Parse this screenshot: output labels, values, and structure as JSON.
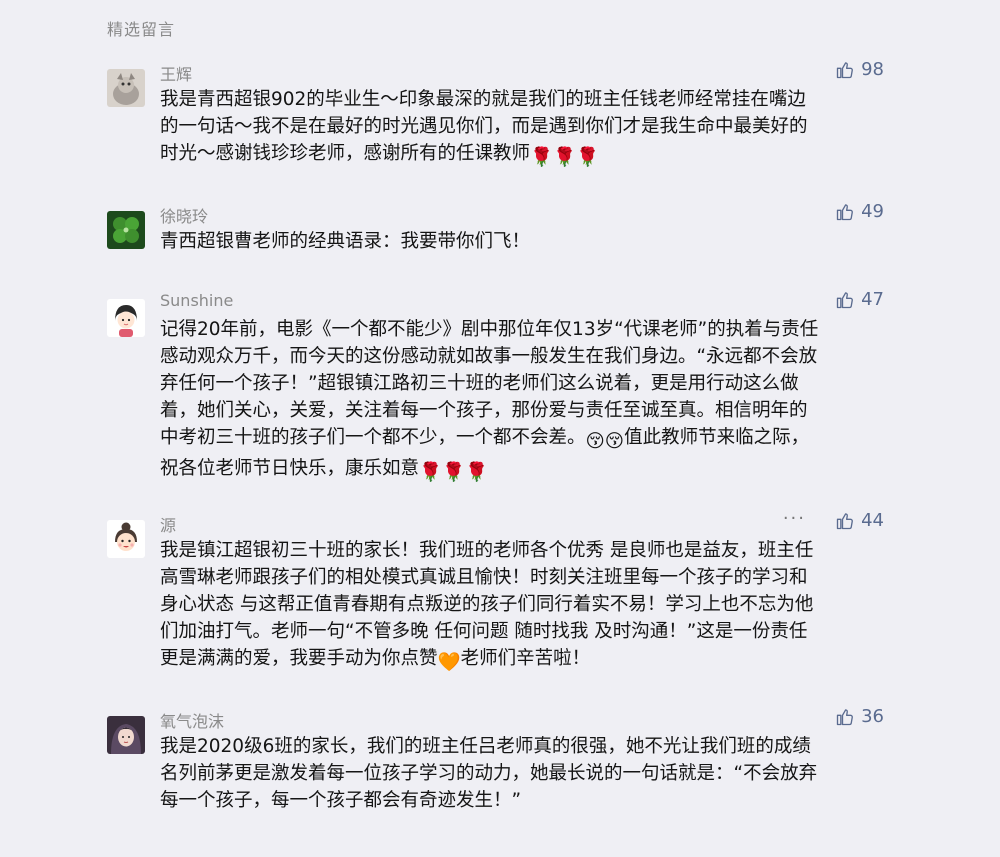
{
  "section_title": "精选留言",
  "comments": [
    {
      "name": "王辉",
      "likes": "98",
      "text": "我是青西超银902的毕业生～印象最深的就是我们的班主任钱老师经常挂在嘴边\n的一句话～我不是在最好的时光遇见你们，而是遇到你们才是我生命中最美好的\n时光～感谢钱珍珍老师，感谢所有的任课教师",
      "emoji_suffix": "🌹🌹🌹"
    },
    {
      "name": "徐晓玲",
      "likes": "49",
      "text": "青西超银曹老师的经典语录：我要带你们飞！"
    },
    {
      "name": "Sunshine",
      "likes": "47",
      "text_a": "记得20年前，电影《一个都不能少》剧中那位年仅13岁“代课老师”的执着与责任\n感动观众万千，而今天的这份感动就如故事一般发生在我们身边。“永远都不会放\n弃任何一个孩子！”超银镇江路初三十班的老师们这么说着，更是用行动这么做\n着，她们关心，关爱，关注着每一个孩子，那份爱与责任至诚至真。相信明年的\n中考初三十班的孩子们一个都不少，一个都不会差。",
      "emoji_mid": "😚😚",
      "text_b": "值此教师节来临之际，\n祝各位老师节日快乐，康乐如意",
      "emoji_suffix": "🌹🌹🌹"
    },
    {
      "name": "源",
      "likes": "44",
      "more": "···",
      "text_a": "我是镇江超银初三十班的家长！我们班的老师各个优秀 是良师也是益友，班主任\n高雪琳老师跟孩子们的相处模式真诚且愉快！时刻关注班里每一个孩子的学习和\n身心状态 与这帮正值青春期有点叛逆的孩子们同行着实不易！学习上也不忘为他\n们加油打气。老师一句“不管多晚 任何问题 随时找我 及时沟通！”这是一份责任\n更是满满的爱，我要手动为你点赞",
      "emoji_mid": "🧡",
      "text_b": "老师们辛苦啦！"
    },
    {
      "name": "氧气泡沫",
      "likes": "36",
      "text": "我是2020级6班的家长，我们的班主任吕老师真的很强，她不光让我们班的成绩\n名列前茅更是激发着每一位孩子学习的动力，她最长说的一句话就是：“不会放弃\n每一个孩子，每一个孩子都会有奇迹发生！”"
    }
  ]
}
